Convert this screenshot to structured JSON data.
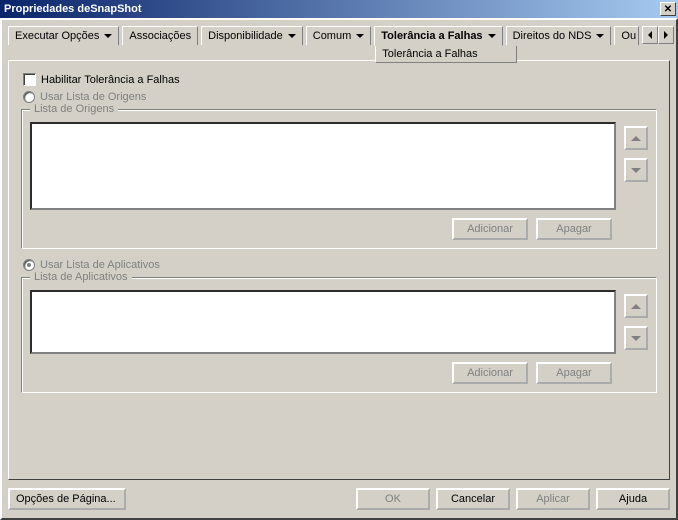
{
  "title": "Propriedades deSnapShot",
  "tabs": {
    "executar": "Executar Opções",
    "associacoes": "Associações",
    "disponibilidade": "Disponibilidade",
    "comum": "Comum",
    "tolerancia": "Tolerância a Falhas",
    "direitos": "Direitos do NDS",
    "outros": "Ou"
  },
  "subtab": "Tolerância a Falhas",
  "checkbox": {
    "habilitar": "Habilitar Tolerância a Falhas"
  },
  "radio": {
    "origens": "Usar Lista de Origens",
    "aplicativos": "Usar Lista de Aplicativos"
  },
  "group": {
    "origens_title": "Lista de Origens",
    "aplicativos_title": "Lista de Aplicativos"
  },
  "buttons": {
    "adicionar": "Adicionar",
    "apagar": "Apagar",
    "opcoes": "Opções de Página...",
    "ok": "OK",
    "cancelar": "Cancelar",
    "aplicar": "Aplicar",
    "ajuda": "Ajuda"
  }
}
